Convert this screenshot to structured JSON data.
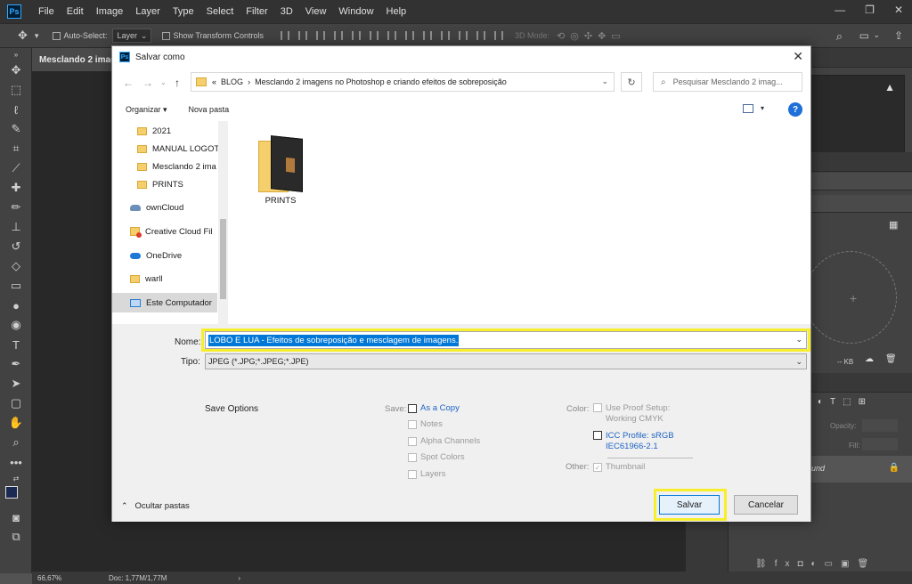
{
  "app": {
    "logo": "Ps",
    "menu": [
      "File",
      "Edit",
      "Image",
      "Layer",
      "Type",
      "Select",
      "Filter",
      "3D",
      "View",
      "Window",
      "Help"
    ],
    "options_bar": {
      "auto_select_label": "Auto-Select:",
      "auto_select_value": "Layer",
      "show_transform_label": "Show Transform Controls",
      "mode_3d_label": "3D Mode:"
    },
    "document_tab": "Mesclando 2 imag",
    "status": {
      "zoom": "66,67%",
      "doc": "Doc: 1,77M/1,77M"
    },
    "right_panel": {
      "kb_text": "-- KB",
      "opacity_label": "Opacity:",
      "fill_label": "Fill:",
      "layer_name": "ound"
    }
  },
  "dialog": {
    "title": "Salvar como",
    "address": {
      "prefix": "«",
      "path": [
        "BLOG",
        "Mesclando 2 imagens no Photoshop e criando efeitos de sobreposição"
      ]
    },
    "search_placeholder": "Pesquisar Mesclando 2 imag...",
    "toolbar": {
      "organize": "Organizar ▾",
      "new_folder": "Nova pasta"
    },
    "nav_items": [
      {
        "label": "2021",
        "icon": "folder-icon"
      },
      {
        "label": "MANUAL LOGOT",
        "icon": "folder-icon"
      },
      {
        "label": "Mesclando 2 ima",
        "icon": "folder-icon"
      },
      {
        "label": "PRINTS",
        "icon": "folder-icon"
      },
      {
        "label": "ownCloud",
        "icon": "cloud-icon"
      },
      {
        "label": "Creative Cloud Fil",
        "icon": "creative-cloud-icon"
      },
      {
        "label": "OneDrive",
        "icon": "onedrive-icon"
      },
      {
        "label": "warll",
        "icon": "folder-icon"
      },
      {
        "label": "Este Computador",
        "icon": "computer-icon"
      }
    ],
    "files": [
      {
        "name": "PRINTS",
        "icon": "folder-with-image-icon"
      }
    ],
    "nome_label": "Nome:",
    "nome_value": "LOBO E LUA - Efeitos de sobreposição e mesclagem de imagens.",
    "tipo_label": "Tipo:",
    "tipo_value": "JPEG (*.JPG;*.JPEG;*.JPE)",
    "save_options_label": "Save Options",
    "save_label": "Save:",
    "save_opts": [
      {
        "label": "As a Copy",
        "enabled": true,
        "checked": false
      },
      {
        "label": "Notes",
        "enabled": false,
        "checked": false
      },
      {
        "label": "Alpha Channels",
        "enabled": false,
        "checked": false
      },
      {
        "label": "Spot Colors",
        "enabled": false,
        "checked": false
      },
      {
        "label": "Layers",
        "enabled": false,
        "checked": false
      }
    ],
    "color_label": "Color:",
    "use_proof_setup": [
      "Use Proof Setup:",
      "Working CMYK"
    ],
    "icc_profile": [
      "ICC Profile:  sRGB",
      "IEC61966-2.1"
    ],
    "other_label": "Other:",
    "thumbnail_label": "Thumbnail",
    "hide_folders": "Ocultar pastas",
    "save_button": "Salvar",
    "cancel_button": "Cancelar"
  },
  "colors": {
    "highlight": "#f7ef2b",
    "selection": "#0078d7",
    "link": "#1c63c4"
  }
}
